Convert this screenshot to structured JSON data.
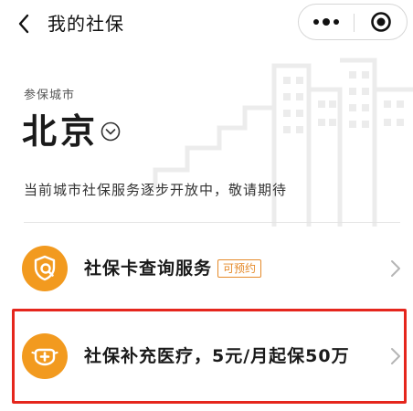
{
  "nav": {
    "title": "我的社保",
    "back_icon": "chevron-left-icon",
    "more_icon": "more-dots-icon",
    "close_icon": "target-circle-icon"
  },
  "city": {
    "label": "参保城市",
    "name": "北京",
    "selector_icon": "chevron-down-circle-icon"
  },
  "notice": "当前城市社保服务逐步开放中，敬请期待",
  "services": [
    {
      "label": "社保卡查询服务",
      "badge": "可预约",
      "icon": "shield-search-icon"
    },
    {
      "label": "社保补充医疗，5元/月起保50万",
      "icon": "medical-mask-icon"
    }
  ],
  "colors": {
    "accent": "#f29a1f",
    "badge": "#e58a2a",
    "highlight": "#e5261d"
  }
}
